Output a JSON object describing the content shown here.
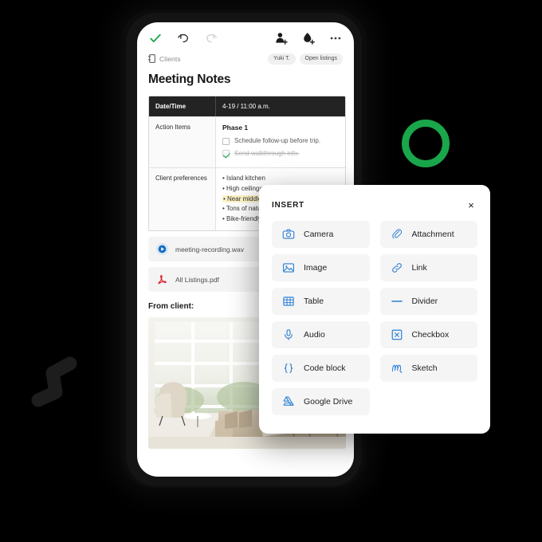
{
  "toolbar": {
    "left_icons": [
      {
        "name": "check-icon",
        "label": "Done"
      },
      {
        "name": "undo-icon",
        "label": "Undo"
      },
      {
        "name": "redo-icon",
        "label": "Redo"
      }
    ],
    "right_icons": [
      {
        "name": "add-person-icon",
        "label": "Add person"
      },
      {
        "name": "add-label-icon",
        "label": "Add label"
      },
      {
        "name": "more-options-icon",
        "label": "More"
      }
    ]
  },
  "breadcrumb": {
    "icon": "notebook-icon",
    "label": "Clients"
  },
  "chips": [
    {
      "label": "Yuki T."
    },
    {
      "label": "Open listings"
    }
  ],
  "document": {
    "title": "Meeting Notes",
    "table": {
      "rows": [
        {
          "key": "Date/Time",
          "value": "4-19 / 11:00 a.m.",
          "header": true
        },
        {
          "key": "Action Items",
          "header": false
        },
        {
          "key": "Client preferences",
          "header": false
        }
      ],
      "phase_label": "Phase 1",
      "tasks": [
        {
          "label": "Schedule follow-up before trip.",
          "done": false
        },
        {
          "label": "Send walkthrough info.",
          "done": true
        }
      ],
      "preferences": [
        {
          "text": "• Island kitchen",
          "highlight": false
        },
        {
          "text": "• High ceilings",
          "highlight": false
        },
        {
          "text": "• Near middle school",
          "highlight": true
        },
        {
          "text": "• Tons of natural light",
          "highlight": false
        },
        {
          "text": "• Bike-friendly streets",
          "highlight": false
        }
      ]
    },
    "attachments": [
      {
        "name": "meeting-recording.wav",
        "icon": "play-circle-icon"
      },
      {
        "name": "All Listings.pdf",
        "icon": "pdf-icon"
      }
    ],
    "from_client_label": "From client:",
    "photo_alt": "living-room-photo"
  },
  "insert_panel": {
    "title": "INSERT",
    "close_label": "×",
    "items": [
      {
        "label": "Camera",
        "icon": "camera-icon"
      },
      {
        "label": "Attachment",
        "icon": "paperclip-icon"
      },
      {
        "label": "Image",
        "icon": "image-icon"
      },
      {
        "label": "Link",
        "icon": "link-icon"
      },
      {
        "label": "Table",
        "icon": "table-icon"
      },
      {
        "label": "Divider",
        "icon": "divider-icon"
      },
      {
        "label": "Audio",
        "icon": "microphone-icon"
      },
      {
        "label": "Checkbox",
        "icon": "checkbox-icon"
      },
      {
        "label": "Code block",
        "icon": "code-braces-icon"
      },
      {
        "label": "Sketch",
        "icon": "sketch-icon"
      },
      {
        "label": "Google Drive",
        "icon": "google-drive-icon"
      }
    ]
  },
  "colors": {
    "accent_green": "#1aa64b",
    "icon_blue": "#2a7fd4",
    "table_header_bg": "#232323",
    "highlight_yellow": "#fdf3c4",
    "background": "#000000"
  }
}
